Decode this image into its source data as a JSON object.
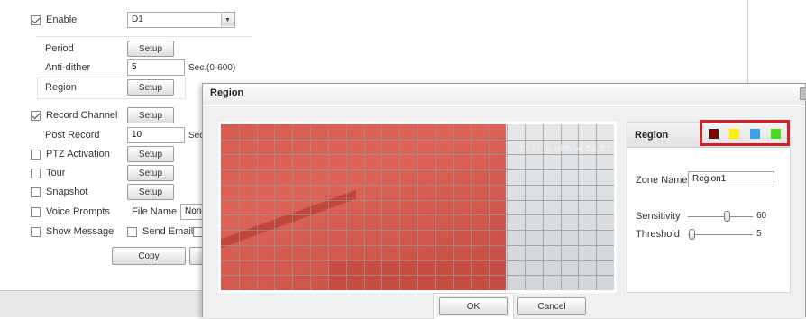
{
  "settings": {
    "enable": {
      "label": "Enable",
      "checked": true,
      "select_value": "D1"
    },
    "period": {
      "label": "Period",
      "button": "Setup"
    },
    "anti_dither": {
      "label": "Anti-dither",
      "value": "5",
      "unit": "Sec.(0-600)"
    },
    "region": {
      "label": "Region",
      "button": "Setup"
    },
    "record_channel": {
      "label": "Record Channel",
      "checked": true,
      "button": "Setup"
    },
    "post_record": {
      "label": "Post Record",
      "value": "10",
      "unit": "Sec"
    },
    "ptz_activation": {
      "label": "PTZ Activation",
      "checked": false,
      "button": "Setup"
    },
    "tour": {
      "label": "Tour",
      "checked": false,
      "button": "Setup"
    },
    "snapshot": {
      "label": "Snapshot",
      "checked": false,
      "button": "Setup"
    },
    "voice_prompts": {
      "label": "Voice Prompts",
      "checked": false,
      "file_name_label": "File Name",
      "file_value": "None"
    },
    "show_message": {
      "label": "Show Message",
      "checked": false,
      "send_email_label": "Send Email",
      "send_email_checked": false
    },
    "copy_button": "Copy"
  },
  "dialog": {
    "title": "Region",
    "timestamp": "1 i i i lg altn i4 58 21",
    "side_panel": {
      "title": "Region",
      "swatch_colors": [
        "#8b0000",
        "#ffee00",
        "#3aa0f0",
        "#44dd22"
      ],
      "selected_swatch": 0,
      "zone_name_label": "Zone Name",
      "zone_name_value": "Region1",
      "sensitivity_label": "Sensitivity",
      "sensitivity_value": "60",
      "sensitivity_level": 0.6,
      "threshold_label": "Threshold",
      "threshold_value": "5",
      "threshold_level": 0.05
    },
    "ok_button": "OK",
    "cancel_button": "Cancel"
  },
  "colors": {
    "region_overlay": "#d62c20",
    "highlight_box": "#d0202a"
  }
}
